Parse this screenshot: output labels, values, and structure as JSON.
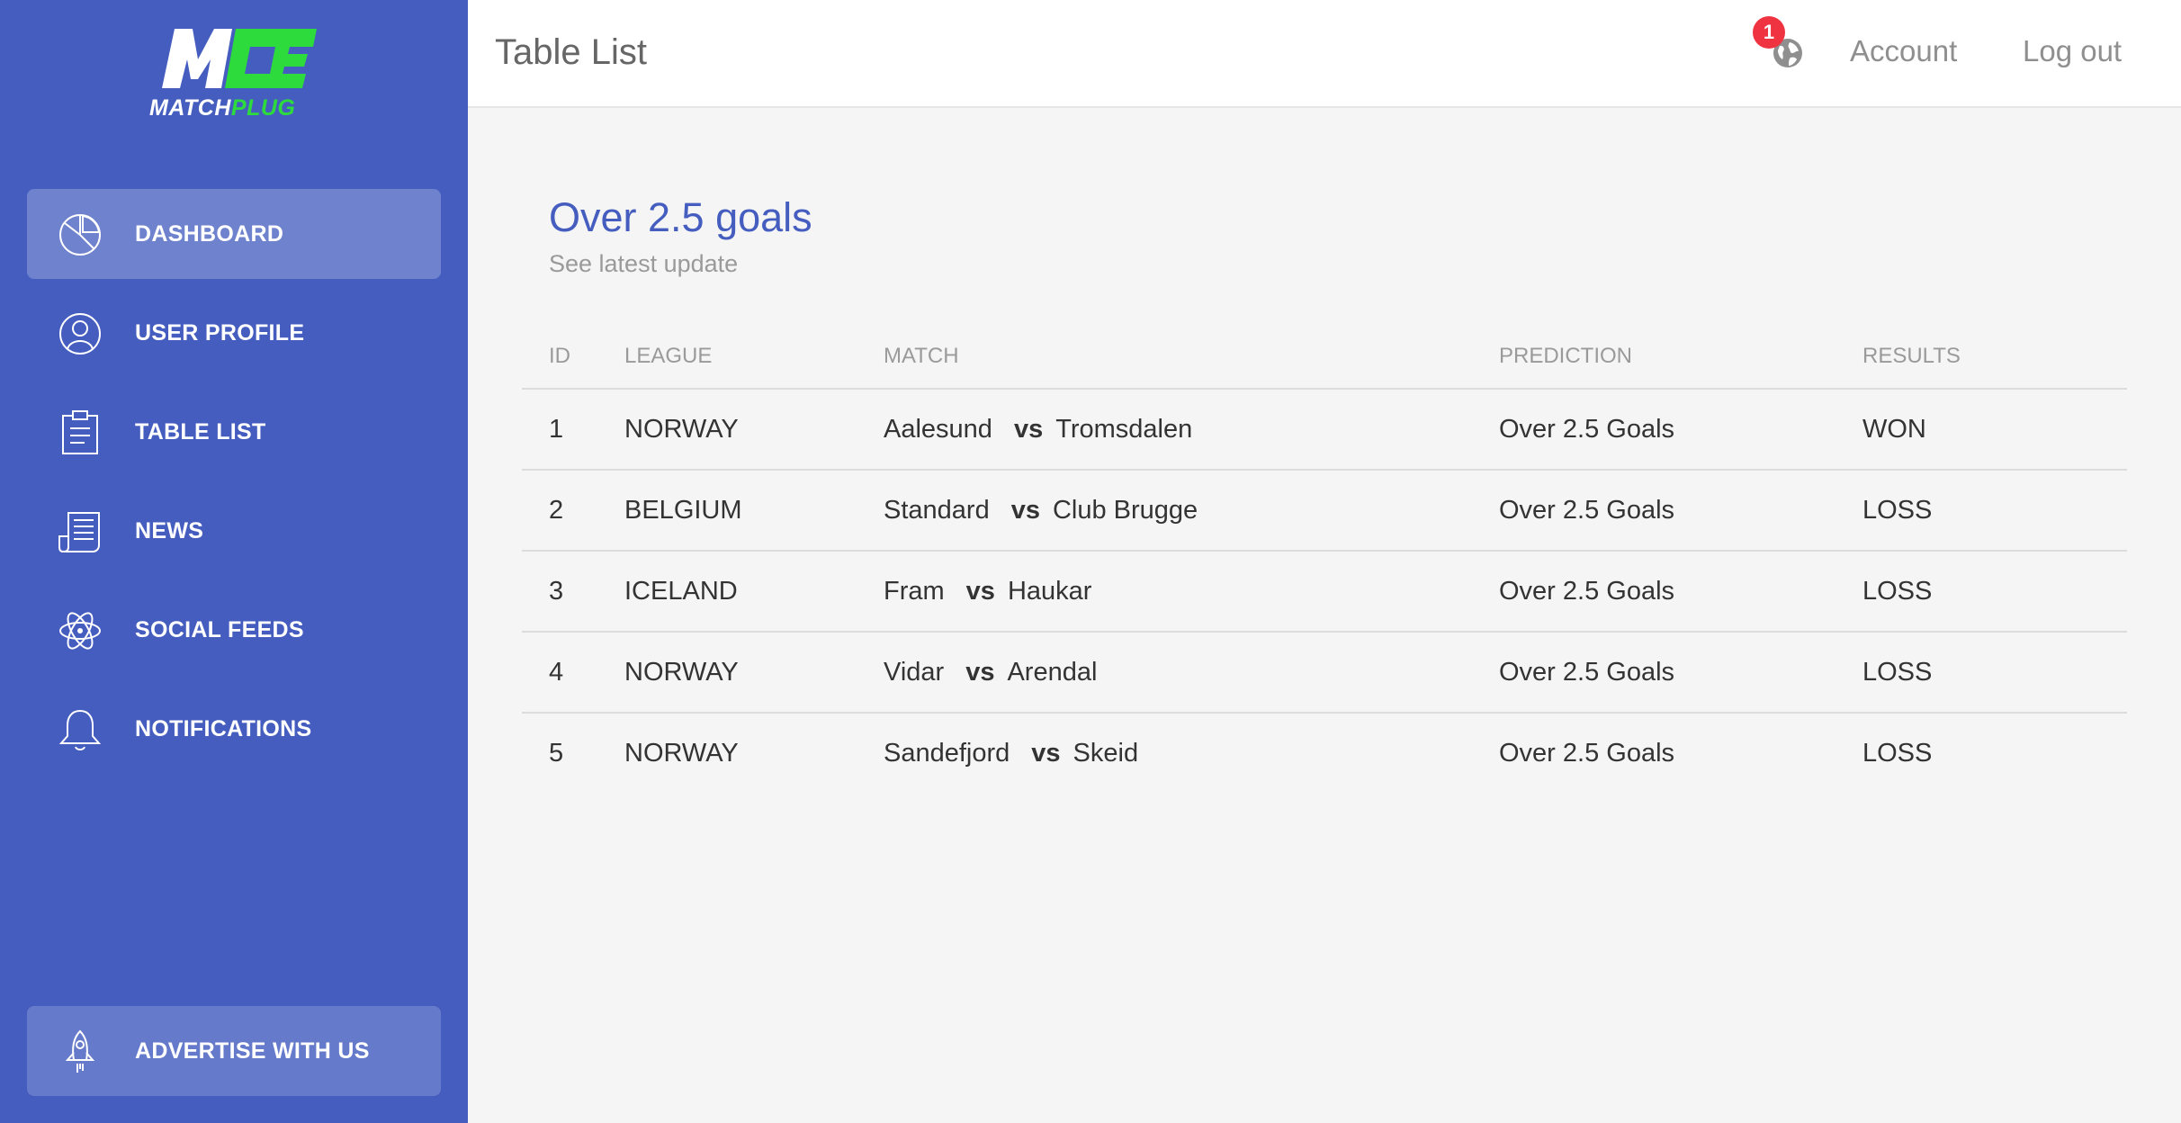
{
  "brand": {
    "logo_mark": "M",
    "logo_word_1": "MATCH",
    "logo_word_2": "PLUG",
    "green": "#2ddb3c",
    "sidebar_color": "#445dbf"
  },
  "sidebar": {
    "items": [
      {
        "label": "DASHBOARD",
        "icon": "pie-chart-icon",
        "active": true
      },
      {
        "label": "USER PROFILE",
        "icon": "user-icon",
        "active": false
      },
      {
        "label": "TABLE LIST",
        "icon": "clipboard-icon",
        "active": false
      },
      {
        "label": "NEWS",
        "icon": "newspaper-icon",
        "active": false
      },
      {
        "label": "SOCIAL FEEDS",
        "icon": "atom-icon",
        "active": false
      },
      {
        "label": "NOTIFICATIONS",
        "icon": "bell-icon",
        "active": false
      }
    ],
    "advertise_label": "ADVERTISE WITH US",
    "advertise_icon": "rocket-icon"
  },
  "header": {
    "title": "Table List",
    "notification_count": "1",
    "account_label": "Account",
    "logout_label": "Log out"
  },
  "card": {
    "title": "Over 2.5 goals",
    "subtitle": "See latest update",
    "columns": [
      "ID",
      "LEAGUE",
      "MATCH",
      "PREDICTION",
      "RESULTS"
    ],
    "vs_label": "vs",
    "rows": [
      {
        "id": "1",
        "league": "NORWAY",
        "home": "Aalesund",
        "away": "Tromsdalen",
        "prediction": "Over 2.5 Goals",
        "result": "WON"
      },
      {
        "id": "2",
        "league": "BELGIUM",
        "home": "Standard",
        "away": "Club Brugge",
        "prediction": "Over 2.5 Goals",
        "result": "LOSS"
      },
      {
        "id": "3",
        "league": "ICELAND",
        "home": "Fram",
        "away": "Haukar",
        "prediction": "Over 2.5 Goals",
        "result": "LOSS"
      },
      {
        "id": "4",
        "league": "NORWAY",
        "home": "Vidar",
        "away": "Arendal",
        "prediction": "Over 2.5 Goals",
        "result": "LOSS"
      },
      {
        "id": "5",
        "league": "NORWAY",
        "home": "Sandefjord",
        "away": "Skeid",
        "prediction": "Over 2.5 Goals",
        "result": "LOSS"
      }
    ]
  }
}
